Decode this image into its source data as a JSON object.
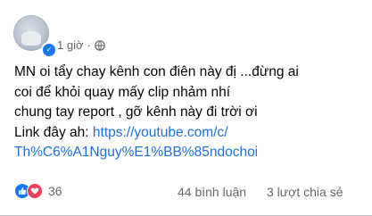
{
  "post": {
    "timestamp": "1 giờ",
    "separator": "·",
    "text_lines": [
      "MN oi tẩy chay kênh con điên này đị ...đừng ai",
      "coi để khỏi quay mấy clip nhảm nhí",
      " chung tay report , gỡ kênh này đi trời ơi"
    ],
    "link_prefix": "Link đây ah: ",
    "link_line1": "https://youtube.com/c/",
    "link_line2": "Th%C6%A1Nguy%E1%BB%85ndochoi"
  },
  "footer": {
    "reaction_count": "36",
    "comments": "44 bình luận",
    "shares": "3 lượt chia sẻ",
    "reaction_icons": [
      "like-icon",
      "love-icon"
    ]
  },
  "colors": {
    "link": "#216fdb",
    "muted": "#65676b",
    "like": "#1877f2",
    "love": "#f33e58"
  }
}
